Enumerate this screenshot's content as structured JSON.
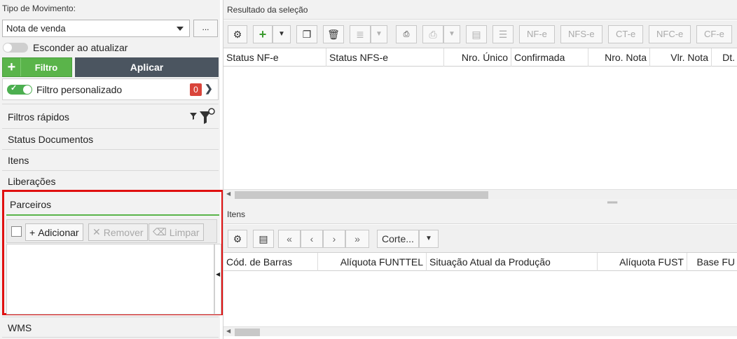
{
  "left": {
    "tipo_label": "Tipo de Movimento:",
    "tipo_value": "Nota de venda",
    "ellipsis": "...",
    "esconder_label": "Esconder ao atualizar",
    "filtro_plus": "+",
    "filtro_label": "Filtro",
    "aplicar_label": "Aplicar",
    "filtro_pers_label": "Filtro personalizado",
    "filtro_pers_count": "0",
    "filtros_rapidos": "Filtros rápidos",
    "sections": {
      "status_documentos": "Status Documentos",
      "itens": "Itens",
      "liberacoes": "Liberações",
      "parceiros": "Parceiros",
      "wms": "WMS"
    },
    "parceiros_toolbar": {
      "adicionar": "Adicionar",
      "remover": "Remover",
      "limpar": "Limpar"
    }
  },
  "right": {
    "resultado_title": "Resultado da seleção",
    "toolbar_text_buttons": [
      "NF-e",
      "NFS-e",
      "CT-e",
      "NFC-e",
      "CF-e"
    ],
    "result_columns": [
      "Status NF-e",
      "Status NFS-e",
      "Nro. Único",
      "Confirmada",
      "Nro. Nota",
      "Vlr. Nota",
      "Dt."
    ],
    "itens_title": "Itens",
    "corte_label": "Corte...",
    "itens_columns": [
      "Cód. de Barras",
      "Alíquota FUNTTEL",
      "Situação Atual da Produção",
      "Alíquota FUST",
      "Base FU"
    ]
  },
  "colors": {
    "green": "#5ab44a",
    "dark": "#4b5560",
    "badge_red": "#d9443a",
    "highlight_red": "#e01010"
  }
}
